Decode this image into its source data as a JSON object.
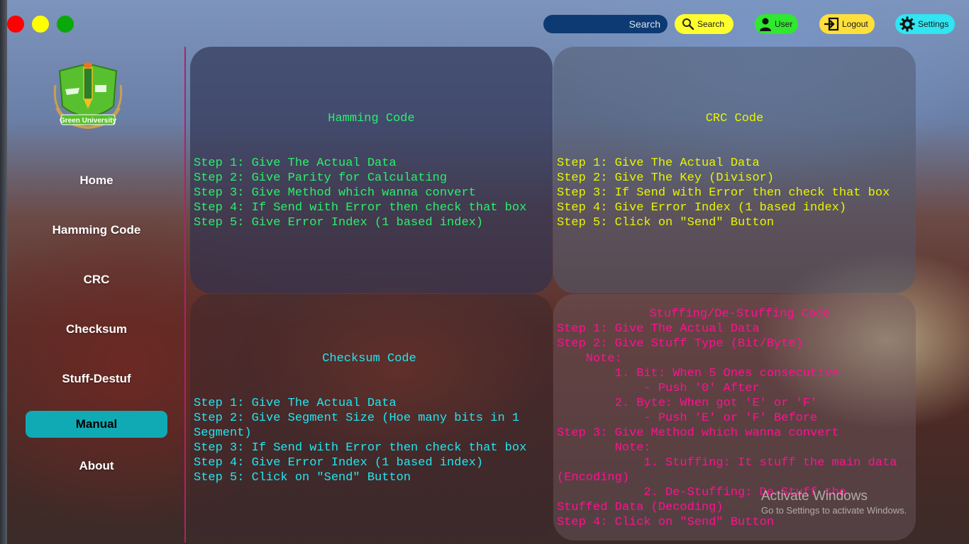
{
  "window_controls": {
    "close_color": "#ff0000",
    "minimize_color": "#ffff00",
    "maximize_color": "#0aa80a"
  },
  "header": {
    "search_placeholder": "Search",
    "search_button_label": "Search",
    "user_button_label": "User",
    "logout_button_label": "Logout",
    "settings_button_label": "Settings"
  },
  "sidebar": {
    "logo_text": "Green University",
    "items": [
      {
        "label": "Home"
      },
      {
        "label": "Hamming Code"
      },
      {
        "label": "CRC"
      },
      {
        "label": "Checksum"
      },
      {
        "label": "Stuff-Destuf"
      },
      {
        "label": "Manual",
        "active": true
      },
      {
        "label": "About"
      }
    ],
    "active_color": "#10aab5"
  },
  "panels": {
    "hamming": {
      "title": "Hamming Code",
      "color": "#2af06a",
      "steps": "Step 1: Give The Actual Data\nStep 2: Give Parity for Calculating\nStep 3: Give Method which wanna convert\nStep 4: If Send with Error then check that box\nStep 5: Give Error Index (1 based index)"
    },
    "crc": {
      "title": "CRC Code",
      "color": "#e8f500",
      "steps": "Step 1: Give The Actual Data\nStep 2: Give The Key (Divisor)\nStep 3: If Send with Error then check that box\nStep 4: Give Error Index (1 based index)\nStep 5: Click on \"Send\" Button"
    },
    "checksum": {
      "title": "Checksum Code",
      "color": "#22e6f0",
      "steps": "Step 1: Give The Actual Data\nStep 2: Give Segment Size (Hoe many bits in 1 Segment)\nStep 3: If Send with Error then check that box\nStep 4: Give Error Index (1 based index)\nStep 5: Click on \"Send\" Button"
    },
    "stuffing": {
      "title": "Stuffing/De-Stuffing Code",
      "color": "#ff1190",
      "steps": "Step 1: Give The Actual Data\nStep 2: Give Stuff Type (Bit/Byte)\n    Note:\n        1. Bit: When 5 Ones consecutive\n            - Push '0' After\n        2. Byte: When got 'E' or 'F'\n            - Push 'E' or 'F' Before\nStep 3: Give Method which wanna convert\n        Note:\n            1. Stuffing: It stuff the main data\n(Encoding)\n            2. De-Stuffing: De-Stuff the\nStuffed Data (Decoding)\nStep 4: Click on \"Send\" Button"
    }
  },
  "watermark": {
    "line1": "Activate Windows",
    "line2": "Go to Settings to activate Windows."
  }
}
